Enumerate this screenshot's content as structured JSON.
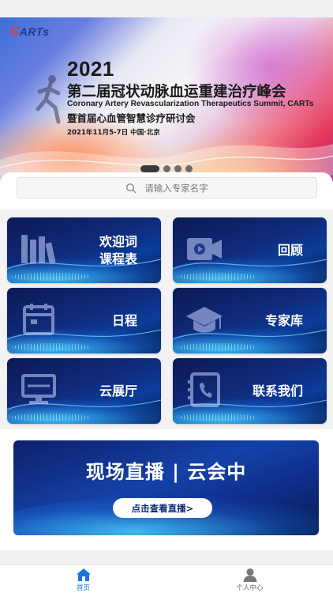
{
  "banner": {
    "logo": "ARTs",
    "logo_initial": "C",
    "year": "2021",
    "title": "第二届冠状动脉血运重建治疗峰会",
    "subtitle_en": "Coronary Artery Revascularization Therapeutics Summit, CARTs",
    "subtitle_cn": "暨首届心血管智慧诊疗研讨会",
    "date_location": "2021年11月5-7日  中国·北京",
    "carousel_dots": 4,
    "active_dot": 0
  },
  "search": {
    "placeholder": "请输入专家名字",
    "icon": "search-icon"
  },
  "menu": {
    "items": [
      {
        "label_line1": "欢迎词",
        "label_line2": "课程表",
        "icon": "books-icon"
      },
      {
        "label_line1": "回顾",
        "label_line2": "",
        "icon": "video-camera-icon"
      },
      {
        "label_line1": "日程",
        "label_line2": "",
        "icon": "calendar-icon"
      },
      {
        "label_line1": "专家库",
        "label_line2": "",
        "icon": "graduation-cap-icon"
      },
      {
        "label_line1": "云展厅",
        "label_line2": "",
        "icon": "monitor-icon"
      },
      {
        "label_line1": "联系我们",
        "label_line2": "",
        "icon": "phone-book-icon"
      }
    ]
  },
  "live": {
    "title": "现场直播 | 云会中",
    "button": "点击查看直播>"
  },
  "tabbar": {
    "tabs": [
      {
        "label": "首页",
        "icon": "home-icon",
        "active": true
      },
      {
        "label": "个人中心",
        "icon": "user-icon",
        "active": false
      }
    ],
    "active_color": "#1677d8"
  }
}
